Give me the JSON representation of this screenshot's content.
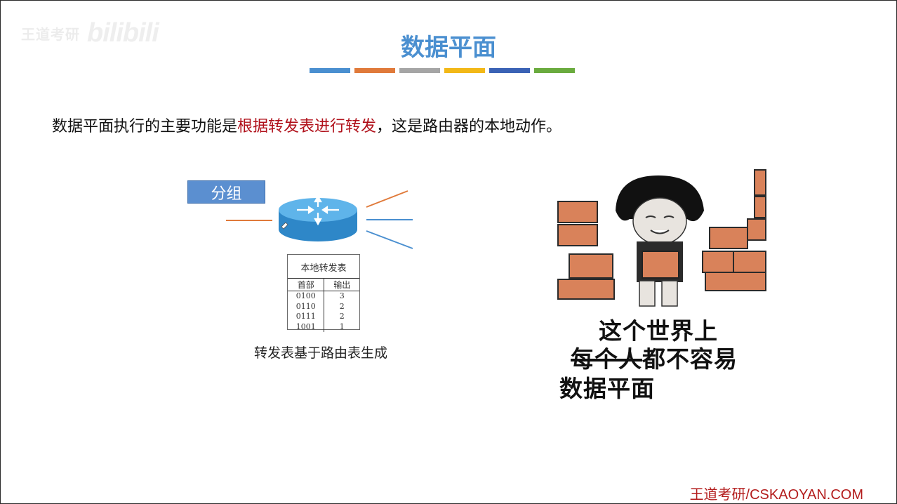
{
  "watermark": {
    "cn": "王道考研",
    "en": "bilibili"
  },
  "slide": {
    "title": "数据平面",
    "stripe_colors": [
      "#4a8fd0",
      "#e07a3a",
      "#a5a5a5",
      "#f2b817",
      "#3a62b5",
      "#6aab3e"
    ],
    "main_text_prefix": "数据平面执行的主要功能是",
    "main_text_highlight": "根据转发表进行转发",
    "main_text_suffix": "，这是路由器的本地动作。"
  },
  "diagram": {
    "packet_label": "分组",
    "table": {
      "title": "本地转发表",
      "headers": [
        "首部",
        "输出"
      ],
      "rows": [
        [
          "0100",
          "3"
        ],
        [
          "0110",
          "2"
        ],
        [
          "0111",
          "2"
        ],
        [
          "1001",
          "1"
        ]
      ]
    },
    "caption": "转发表基于路由表生成"
  },
  "meme": {
    "line1": "这个世界上",
    "line2_strike": "每个人",
    "line2_rest": "都不容易",
    "line3": "数据平面"
  },
  "footer": "王道考研/CSKAOYAN.COM"
}
